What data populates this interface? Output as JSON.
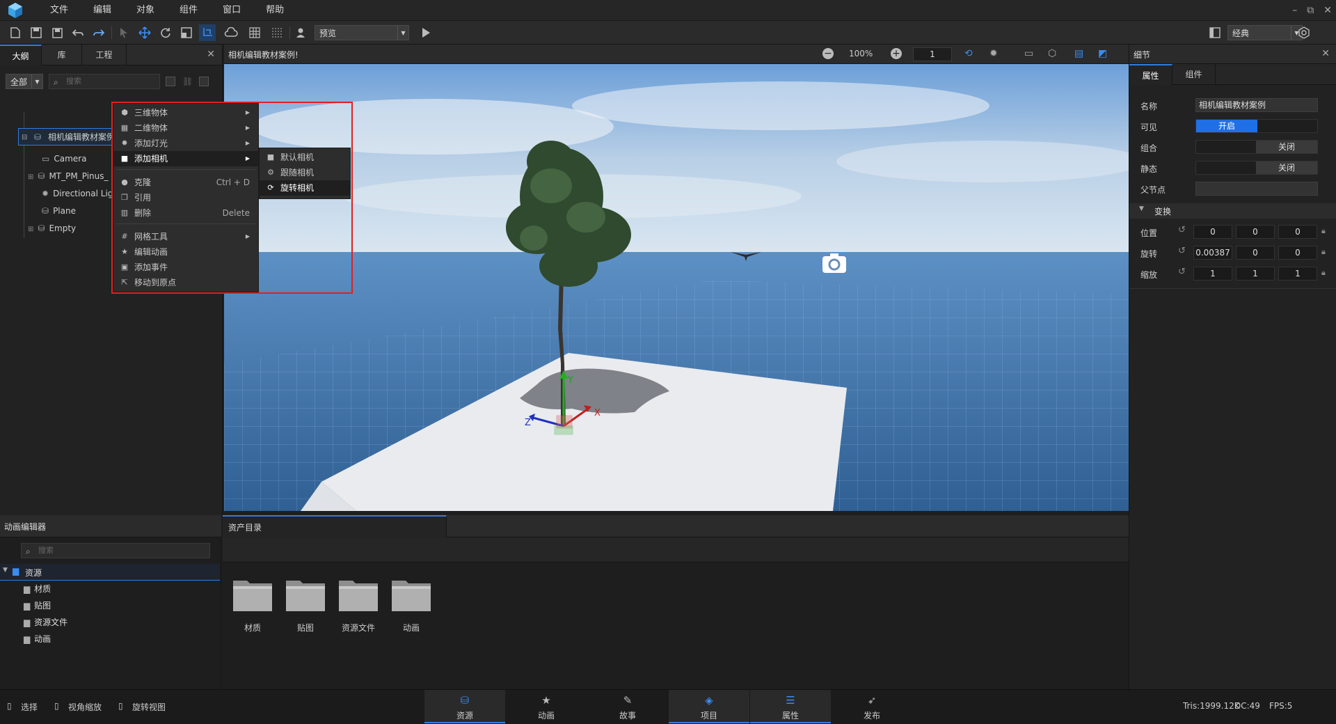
{
  "menubar": {
    "items": [
      "文件",
      "编辑",
      "对象",
      "组件",
      "窗口",
      "帮助"
    ],
    "window_controls": [
      "–",
      "⧉",
      "✕"
    ]
  },
  "toolbar": {
    "mode_select": "预览",
    "layout_select": "经典"
  },
  "outline": {
    "tabs": [
      "大纲",
      "库",
      "工程"
    ],
    "filter": "全部",
    "search_placeholder": "搜索",
    "root": "相机编辑教材案例",
    "items": [
      "Camera",
      "MT_PM_Pinus_",
      "Directional Ligl",
      "Plane",
      "Empty"
    ]
  },
  "viewport": {
    "title": "相机编辑教材案例!",
    "zoom": "100%",
    "speed": "1",
    "axis_x": "X",
    "axis_y": "Y",
    "axis_z": "Z"
  },
  "context_menu": {
    "items": [
      {
        "label": "三维物体",
        "icon": "cube-icon",
        "submenu": true
      },
      {
        "label": "二维物体",
        "icon": "grid-icon",
        "submenu": true
      },
      {
        "label": "添加灯光",
        "icon": "light-icon",
        "submenu": true
      },
      {
        "label": "添加相机",
        "icon": "camera-icon",
        "submenu": true
      },
      {
        "label": "克隆",
        "icon": "clone-icon",
        "shortcut": "Ctrl + D"
      },
      {
        "label": "引用",
        "icon": "reference-icon"
      },
      {
        "label": "删除",
        "icon": "trash-icon",
        "shortcut": "Delete"
      },
      {
        "label": "网格工具",
        "icon": "mesh-icon",
        "submenu": true
      },
      {
        "label": "编辑动画",
        "icon": "star-icon"
      },
      {
        "label": "添加事件",
        "icon": "event-icon"
      },
      {
        "label": "移动到原点",
        "icon": "origin-icon"
      }
    ],
    "submenu": [
      "默认相机",
      "跟随相机",
      "旋转相机"
    ]
  },
  "details": {
    "title": "细节",
    "tabs": [
      "属性",
      "组件"
    ],
    "name_label": "名称",
    "name_value": "相机编辑教材案例",
    "visible_label": "可见",
    "visible_on": "开启",
    "group_label": "组合",
    "group_off": "关闭",
    "static_label": "静态",
    "static_off": "关闭",
    "parent_label": "父节点",
    "transform_label": "变换",
    "position_label": "位置",
    "position": [
      "0",
      "0",
      "0"
    ],
    "rotation_label": "旋转",
    "rotation": [
      "0.00387",
      "0",
      "0"
    ],
    "scale_label": "缩放",
    "scale": [
      "1",
      "1",
      "1"
    ]
  },
  "anim_panel": {
    "title": "动画编辑器",
    "search_placeholder": "搜索",
    "root": "资源",
    "children": [
      "材质",
      "贴图",
      "资源文件",
      "动画"
    ]
  },
  "asset_panel": {
    "title": "资产目录",
    "folders": [
      "材质",
      "贴图",
      "资源文件",
      "动画"
    ]
  },
  "statusbar": {
    "hints": [
      "选择",
      "视角缩放",
      "旋转视图"
    ],
    "tabs": [
      {
        "label": "资源",
        "icon": "resource-icon"
      },
      {
        "label": "动画",
        "icon": "animation-icon"
      },
      {
        "label": "故事",
        "icon": "story-icon"
      },
      {
        "label": "项目",
        "icon": "project-icon"
      },
      {
        "label": "属性",
        "icon": "properties-icon"
      },
      {
        "label": "发布",
        "icon": "publish-icon"
      }
    ],
    "tris": "Tris:1999.12K",
    "dc": "DC:49",
    "fps": "FPS:5"
  },
  "colors": {
    "accent": "#2f7de1",
    "highlight_box": "#e02020"
  }
}
